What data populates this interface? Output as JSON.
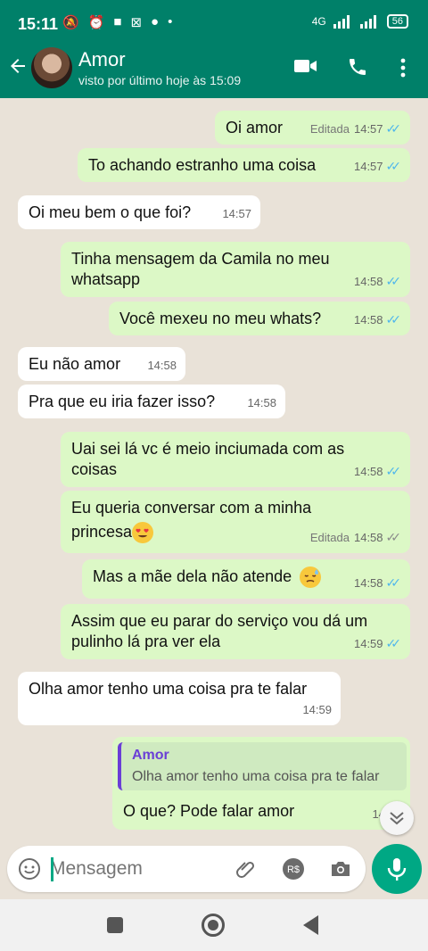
{
  "status_bar": {
    "time": "15:11",
    "network": "4G",
    "battery": "56"
  },
  "header": {
    "contact_name": "Amor",
    "last_seen": "visto por último hoje às 15:09"
  },
  "messages": [
    {
      "dir": "out",
      "text": "Oi amor",
      "edited": "Editada",
      "time": "14:57",
      "read": true
    },
    {
      "dir": "out",
      "text": "To achando estranho uma coisa",
      "time": "14:57",
      "read": true
    },
    {
      "dir": "in",
      "text": "Oi meu bem o que foi?",
      "time": "14:57"
    },
    {
      "dir": "out",
      "line1": "Tinha mensagem da Camila no meu",
      "line2": "whatsapp",
      "time": "14:58",
      "read": true
    },
    {
      "dir": "out",
      "text": "Você mexeu no meu whats?",
      "time": "14:58",
      "read": true
    },
    {
      "dir": "in",
      "text": "Eu não amor",
      "time": "14:58"
    },
    {
      "dir": "in",
      "text": "Pra que eu iria fazer isso?",
      "time": "14:58"
    },
    {
      "dir": "out",
      "line1": "Uai sei lá vc é meio inciumada com as",
      "line2": "coisas",
      "time": "14:58",
      "read": true
    },
    {
      "dir": "out",
      "line1": "Eu queria conversar com a minha",
      "line2": "princesa",
      "emoji": "heart-eyes-emoji",
      "edited": "Editada",
      "time": "14:58",
      "read": false
    },
    {
      "dir": "out",
      "text": "Mas a mãe dela não atende",
      "emoji": "sad-sweat-emoji",
      "time": "14:58",
      "read": true
    },
    {
      "dir": "out",
      "line1": "Assim que eu parar do serviço vou dá um",
      "line2": "pulinho lá pra ver ela",
      "time": "14:59",
      "read": true
    },
    {
      "dir": "in",
      "text": "Olha amor tenho uma coisa pra te falar",
      "time": "14:59"
    },
    {
      "dir": "out",
      "quote_name": "Amor",
      "quote_text": "Olha amor tenho uma coisa pra te falar",
      "text": "O que? Pode falar amor",
      "time": "14:59",
      "read": true
    }
  ],
  "input": {
    "placeholder": "Mensagem"
  },
  "colors": {
    "header": "#008069",
    "outgoing_bubble": "#dcf8c6",
    "incoming_bubble": "#ffffff",
    "read_ticks": "#4fb6ec",
    "accent": "#00a884",
    "quote_bar": "#6a3fd6"
  }
}
